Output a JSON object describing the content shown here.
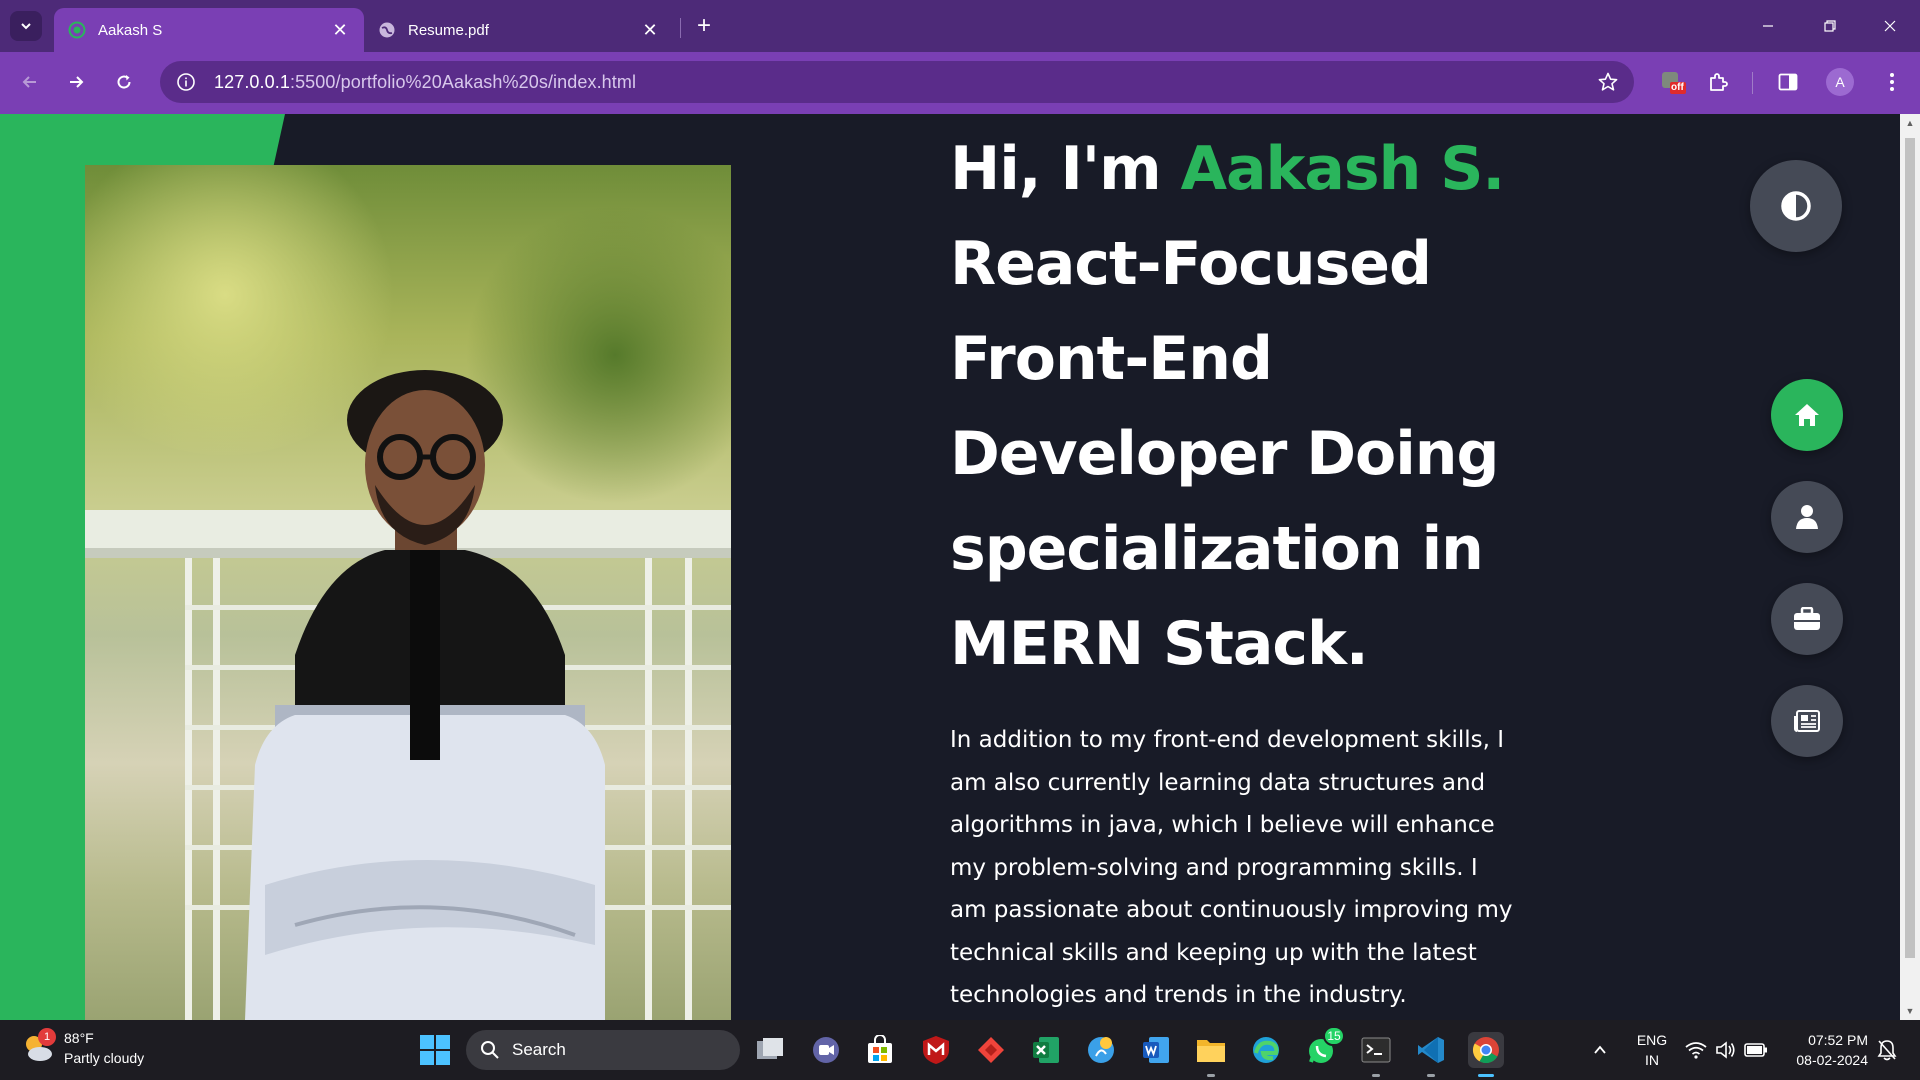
{
  "browser": {
    "tabs": [
      {
        "title": "Aakash S",
        "active": true
      },
      {
        "title": "Resume.pdf",
        "active": false
      }
    ],
    "url_host": "127.0.0.1",
    "url_rest": ":5500/portfolio%20Aakash%20s/index.html",
    "extension_badge": "off",
    "profile_initial": "A"
  },
  "hero": {
    "greeting": "Hi, I'm ",
    "name": "Aakash S.",
    "title_lines": [
      "React-Focused",
      "Front-End",
      "Developer Doing",
      "specialization in",
      "MERN Stack."
    ],
    "paragraph": "In addition to my front-end development skills, I am also currently learning data structures and algorithms in java, which I believe will enhance my problem-solving and programming skills. I am passionate about continuously improving my technical skills and keeping up with the latest technologies and trends in the industry."
  },
  "side_nav": {
    "theme_toggle_icon": "contrast-icon",
    "items": [
      {
        "icon": "home-icon",
        "active": true
      },
      {
        "icon": "user-icon",
        "active": false
      },
      {
        "icon": "briefcase-icon",
        "active": false
      },
      {
        "icon": "newspaper-icon",
        "active": false
      }
    ]
  },
  "taskbar": {
    "weather_temp": "88°F",
    "weather_desc": "Partly cloudy",
    "weather_badge": "1",
    "search_placeholder": "Search",
    "whatsapp_badge": "15",
    "lang_line1": "ENG",
    "lang_line2": "IN",
    "time": "07:52 PM",
    "date": "08-02-2024"
  },
  "colors": {
    "accent": "#2ab55c",
    "page_bg": "#181b27",
    "browser_frame": "#7a3fb4"
  }
}
